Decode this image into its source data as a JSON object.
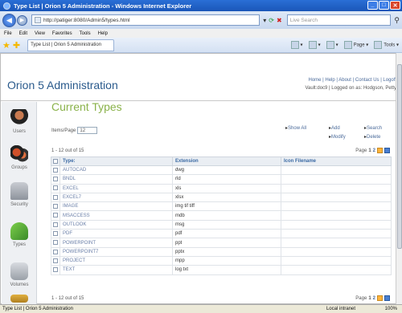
{
  "window": {
    "title": "Type List | Orion 5 Administration - Windows Internet Explorer"
  },
  "address": {
    "url": "http://patiger:8080/Admin5/types.html",
    "search_placeholder": "Live Search"
  },
  "menu": [
    "File",
    "Edit",
    "View",
    "Favorites",
    "Tools",
    "Help"
  ],
  "tab": {
    "title": "Type List | Orion 5 Administration"
  },
  "commandbar": {
    "page": "Page",
    "tools": "Tools"
  },
  "header": {
    "app_title": "Orion 5 Administration",
    "links": "Home | Help | About | Contact Us | Logoff",
    "vault_line": "Vault:doc9  |  Logged on as: Hodgson, Petty"
  },
  "sidebar": {
    "items": [
      {
        "label": "Users",
        "color": "#8a4a2a"
      },
      {
        "label": "Groups",
        "color": "#b84a20"
      },
      {
        "label": "Security",
        "color": "#9aa0a8"
      },
      {
        "label": "Types",
        "color": "#5aa03a"
      },
      {
        "label": "Volumes",
        "color": "#a0a4aa"
      }
    ]
  },
  "content": {
    "title": "Current Types",
    "items_per_page_label": "Items/Page",
    "items_per_page_value": "12",
    "actions": {
      "show_all": "Show All",
      "add": "Add",
      "modify": "Modify",
      "search": "Search",
      "delete": "Delete"
    },
    "count_top": "1 - 12 out of 15",
    "count_bottom": "1 - 12 out of 15",
    "pager": {
      "label": "Page",
      "current": "1",
      "next": "2"
    }
  },
  "table": {
    "headers": {
      "type": "Type:",
      "extension": "Extension",
      "icon": "Icon Filename"
    },
    "rows": [
      {
        "type": "AUTOCAD",
        "ext": "dwg"
      },
      {
        "type": "BNDL",
        "ext": "rld"
      },
      {
        "type": "EXCEL",
        "ext": "xls"
      },
      {
        "type": "EXCEL7",
        "ext": "xlsx"
      },
      {
        "type": "IMAGE",
        "ext": "img tif tiff"
      },
      {
        "type": "MSACCESS",
        "ext": "mdb"
      },
      {
        "type": "OUTLOOK",
        "ext": "msg"
      },
      {
        "type": "PDF",
        "ext": "pdf"
      },
      {
        "type": "POWERPOINT",
        "ext": "ppt"
      },
      {
        "type": "POWERPOINT7",
        "ext": "pptx"
      },
      {
        "type": "PROJECT",
        "ext": "mpp"
      },
      {
        "type": "TEXT",
        "ext": "log txt"
      }
    ]
  },
  "status": {
    "text": "Type List | Orion 5 Administration",
    "zone": "Local intranet",
    "zoom": "100%"
  }
}
